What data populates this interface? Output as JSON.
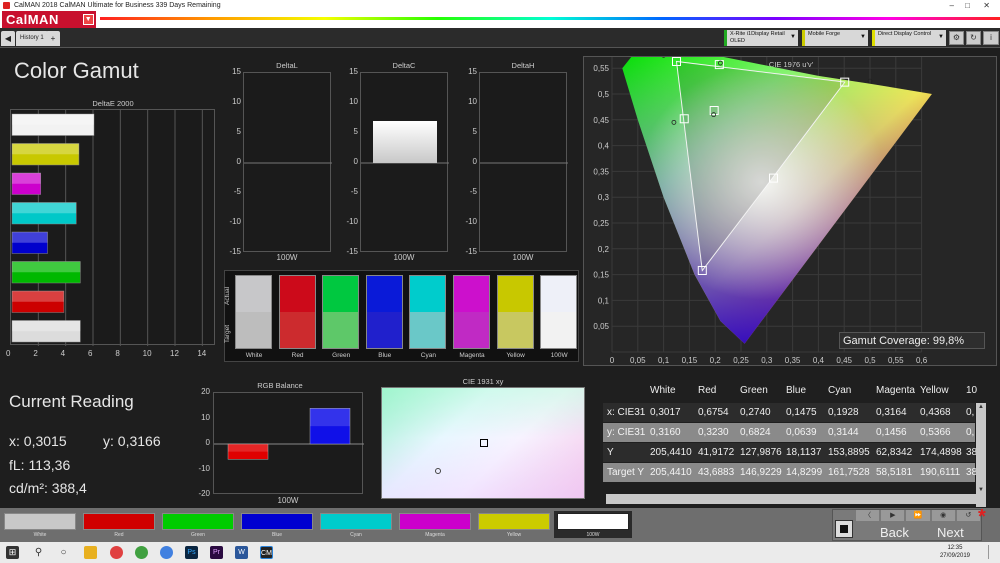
{
  "window": {
    "title": "CalMAN 2018 CalMAN Ultimate for Business 339 Days Remaining",
    "logo": "CalMAN"
  },
  "tabs": [
    {
      "label": "History 1"
    }
  ],
  "devices": [
    {
      "label": "X-Rite i1Display Retail\nOLED",
      "color": "#22aa22"
    },
    {
      "label": "Mobile Forge",
      "color": "#cccc00"
    },
    {
      "label": "Direct Display Control",
      "color": "#dddd00"
    }
  ],
  "page": {
    "title": "Color Gamut"
  },
  "deltaE": {
    "title": "DeltaE 2000",
    "ticks": [
      "0",
      "2",
      "4",
      "6",
      "8",
      "10",
      "12",
      "14"
    ],
    "max": 15,
    "bars": [
      {
        "name": "White",
        "value": 6.0,
        "color": "#f2f2f2"
      },
      {
        "name": "Yellow",
        "value": 4.9,
        "color": "#c8c800"
      },
      {
        "name": "Magenta",
        "value": 2.1,
        "color": "#cc00cc"
      },
      {
        "name": "Cyan",
        "value": 4.7,
        "color": "#00c8c8"
      },
      {
        "name": "Blue",
        "value": 2.6,
        "color": "#0000cc"
      },
      {
        "name": "Green",
        "value": 5.0,
        "color": "#00b800"
      },
      {
        "name": "Red",
        "value": 3.8,
        "color": "#cc0000"
      },
      {
        "name": "Gray",
        "value": 5.0,
        "color": "#dcdcdc"
      }
    ]
  },
  "deltas": [
    {
      "title": "DeltaL",
      "xlabel": "100W",
      "value": 0
    },
    {
      "title": "DeltaC",
      "xlabel": "100W",
      "value": 7
    },
    {
      "title": "DeltaH",
      "xlabel": "100W",
      "value": 0
    }
  ],
  "delta_ticks": [
    "15",
    "10",
    "5",
    "0",
    "-5",
    "-10",
    "-15"
  ],
  "swatch_axis": {
    "actual": "Actual",
    "target": "Target"
  },
  "swatches": [
    {
      "label": "White",
      "actual": "#c7c7c9",
      "target": "#bdbdbd"
    },
    {
      "label": "Red",
      "actual": "#cc0a1a",
      "target": "#cc2b2e"
    },
    {
      "label": "Green",
      "actual": "#00c840",
      "target": "#5ec869"
    },
    {
      "label": "Blue",
      "actual": "#0a1ad8",
      "target": "#2020cc"
    },
    {
      "label": "Cyan",
      "actual": "#00cccc",
      "target": "#6ac8c8"
    },
    {
      "label": "Magenta",
      "actual": "#cc10cc",
      "target": "#c02ac4"
    },
    {
      "label": "Yellow",
      "actual": "#c8c800",
      "target": "#c8c860"
    },
    {
      "label": "100W",
      "actual": "#eef0f8",
      "target": "#f2f2f2"
    }
  ],
  "reading": {
    "title": "Current Reading",
    "x": "x: 0,3015",
    "y": "y: 0,3166",
    "fl": "fL: 113,36",
    "cdm2": "cd/m²: 388,4"
  },
  "rgb_balance": {
    "title": "RGB Balance",
    "xlabel": "100W",
    "ticks": [
      "20",
      "10",
      "0",
      "-10",
      "-20"
    ],
    "red": -6,
    "green": 0,
    "blue": 14
  },
  "cie1931": {
    "title": "CIE 1931 xy"
  },
  "cie1976": {
    "title": "CIE 1976 u'v'",
    "gamut_label": "Gamut Coverage:",
    "gamut_value": "99,8%",
    "yticks": [
      "0,55",
      "0,5",
      "0,45",
      "0,4",
      "0,35",
      "0,3",
      "0,25",
      "0,2",
      "0,15",
      "0,1",
      "0,05"
    ],
    "xticks": [
      "0",
      "0,05",
      "0,1",
      "0,15",
      "0,2",
      "0,25",
      "0,3",
      "0,35",
      "0,4",
      "0,45",
      "0,5",
      "0,55",
      "0,6"
    ]
  },
  "table": {
    "headers": [
      "White",
      "Red",
      "Green",
      "Blue",
      "Cyan",
      "Magenta",
      "Yellow",
      "10"
    ],
    "rows": [
      {
        "label": "x: CIE31",
        "values": [
          "0,3017",
          "0,6754",
          "0,2740",
          "0,1475",
          "0,1928",
          "0,3164",
          "0,4368",
          "0,"
        ]
      },
      {
        "label": "y: CIE31",
        "values": [
          "0,3160",
          "0,3230",
          "0,6824",
          "0,0639",
          "0,3144",
          "0,1456",
          "0,5366",
          "0,"
        ]
      },
      {
        "label": "Y",
        "values": [
          "205,4410",
          "41,9172",
          "127,9876",
          "18,1137",
          "153,8895",
          "62,8342",
          "174,4898",
          "38"
        ]
      },
      {
        "label": "Target Y",
        "values": [
          "205,4410",
          "43,6883",
          "146,9229",
          "14,8299",
          "161,7528",
          "58,5181",
          "190,6111",
          "38"
        ]
      }
    ]
  },
  "color_buttons": [
    {
      "name": "White",
      "color": "#c8c8c8"
    },
    {
      "name": "Red",
      "color": "#d00000"
    },
    {
      "name": "Green",
      "color": "#00cc00"
    },
    {
      "name": "Blue",
      "color": "#0000d0"
    },
    {
      "name": "Cyan",
      "color": "#00cccc"
    },
    {
      "name": "Magenta",
      "color": "#cc00cc"
    },
    {
      "name": "Yellow",
      "color": "#cccc00"
    },
    {
      "name": "100W",
      "color": "#ffffff"
    }
  ],
  "nav": {
    "back": "Back",
    "next": "Next"
  },
  "clock": {
    "time": "12:35",
    "date": "27/09/2019"
  }
}
